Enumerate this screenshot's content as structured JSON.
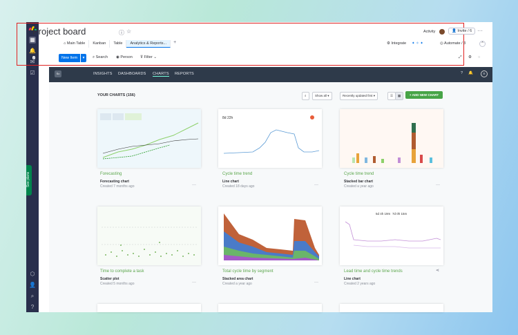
{
  "board": {
    "title": "Project board"
  },
  "header": {
    "activity": "Activity",
    "invite": "Invite / 6",
    "integrate": "Integrate",
    "automate": "Automate / 3"
  },
  "tabs": [
    "Main Table",
    "Kanban",
    "Table",
    "Analytics & Reports..."
  ],
  "toolbar": {
    "new_item": "New Item",
    "search": "Search",
    "person": "Person",
    "filter": "Filter"
  },
  "sidebar": {
    "notifications_badge": "2",
    "see_plans": "See plans"
  },
  "app_nav": {
    "logo": "Sc",
    "items": [
      "INSIGHTS",
      "DASHBOARDS",
      "CHARTS",
      "REPORTS"
    ],
    "active": "CHARTS"
  },
  "charts_header": {
    "title": "YOUR CHARTS (156)",
    "show_all": "Show all",
    "sort": "Recently updated first",
    "add": "+ ADD NEW CHART"
  },
  "cards": [
    {
      "title": "Forecasting",
      "type": "Forecasting chart",
      "date": "Created 7 months ago"
    },
    {
      "title": "Cycle time trend",
      "type": "Line chart",
      "date": "Created 18 days ago"
    },
    {
      "title": "Cycle time trend",
      "type": "Stacked bar chart",
      "date": "Created a year ago"
    },
    {
      "title": "Time to complete a task",
      "type": "Scatter plot",
      "date": "Created 5 months ago"
    },
    {
      "title": "Total cycle time by segment",
      "type": "Stacked area chart",
      "date": "Created a year ago"
    },
    {
      "title": "Lead time and cycle time trends",
      "type": "Line chart",
      "date": "Created 2 years ago"
    }
  ],
  "thumb_labels": {
    "cycle_value": "8d 22h",
    "lead_value": "5d 4h 19m",
    "cycle2_value": "7d 0h 15m"
  },
  "colors": {
    "accent_blue": "#0073ea",
    "green": "#47a447",
    "dark_nav": "#2e3a4a",
    "sidebar": "#292f4c"
  }
}
